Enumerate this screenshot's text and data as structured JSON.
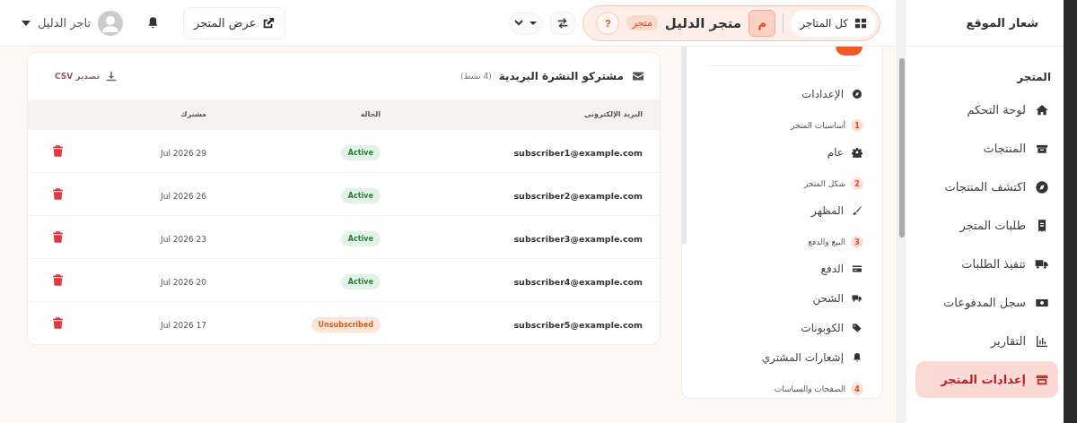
{
  "sidebar": {
    "logo_text": "شعار الموقع",
    "section": "المتجر",
    "items": [
      {
        "label": "لوحة التحكم",
        "selected": false
      },
      {
        "label": "المنتجات",
        "selected": false
      },
      {
        "label": "اكتشف المنتجات",
        "selected": false
      },
      {
        "label": "طلبات المتجر",
        "selected": false
      },
      {
        "label": "تنفيذ الطلبات",
        "selected": false
      },
      {
        "label": "سجل المدفوعات",
        "selected": false
      },
      {
        "label": "التقارير",
        "selected": false
      },
      {
        "label": "إعدادات المتجر",
        "selected": true
      }
    ]
  },
  "topbar": {
    "all_stores": "كل المتاجر",
    "store_initial": "م",
    "store_name": "متجر الدليل",
    "store_badge": "متجر",
    "help": "?",
    "view_store": "عرض المتجر",
    "user_name": "تاجر الدليل"
  },
  "settings_nav": {
    "items": [
      {
        "kind": "link",
        "label": "الإعدادات"
      },
      {
        "kind": "group",
        "number": "1",
        "label": "أساسيات المتجر"
      },
      {
        "kind": "link",
        "label": "عام"
      },
      {
        "kind": "group",
        "number": "2",
        "label": "شكل المتجر"
      },
      {
        "kind": "link",
        "label": "المظهر"
      },
      {
        "kind": "group",
        "number": "3",
        "label": "البيع والدفع"
      },
      {
        "kind": "link",
        "label": "الدفع"
      },
      {
        "kind": "link",
        "label": "الشحن"
      },
      {
        "kind": "link",
        "label": "الكوبونات"
      },
      {
        "kind": "link",
        "label": "إشعارات المشتري"
      },
      {
        "kind": "group",
        "number": "4",
        "label": "الصفحات والسياسات"
      }
    ]
  },
  "subscribers": {
    "title": "مشتركو النشرة البريدية",
    "count": "(4 نشط)",
    "export": "تصدير CSV",
    "columns": [
      "البريد الإلكتروني",
      "الحالة",
      "مشترك"
    ],
    "rows": [
      {
        "email": "subscriber1@example.com",
        "status": "Active",
        "kind": "active",
        "date": "29 Jul 2026"
      },
      {
        "email": "subscriber2@example.com",
        "status": "Active",
        "kind": "active",
        "date": "26 Jul 2026"
      },
      {
        "email": "subscriber3@example.com",
        "status": "Active",
        "kind": "active",
        "date": "23 Jul 2026"
      },
      {
        "email": "subscriber4@example.com",
        "status": "Active",
        "kind": "active",
        "date": "20 Jul 2026"
      },
      {
        "email": "subscriber5@example.com",
        "status": "Unsubscribed",
        "kind": "unsubscribed",
        "date": "17 Jul 2026"
      }
    ]
  }
}
